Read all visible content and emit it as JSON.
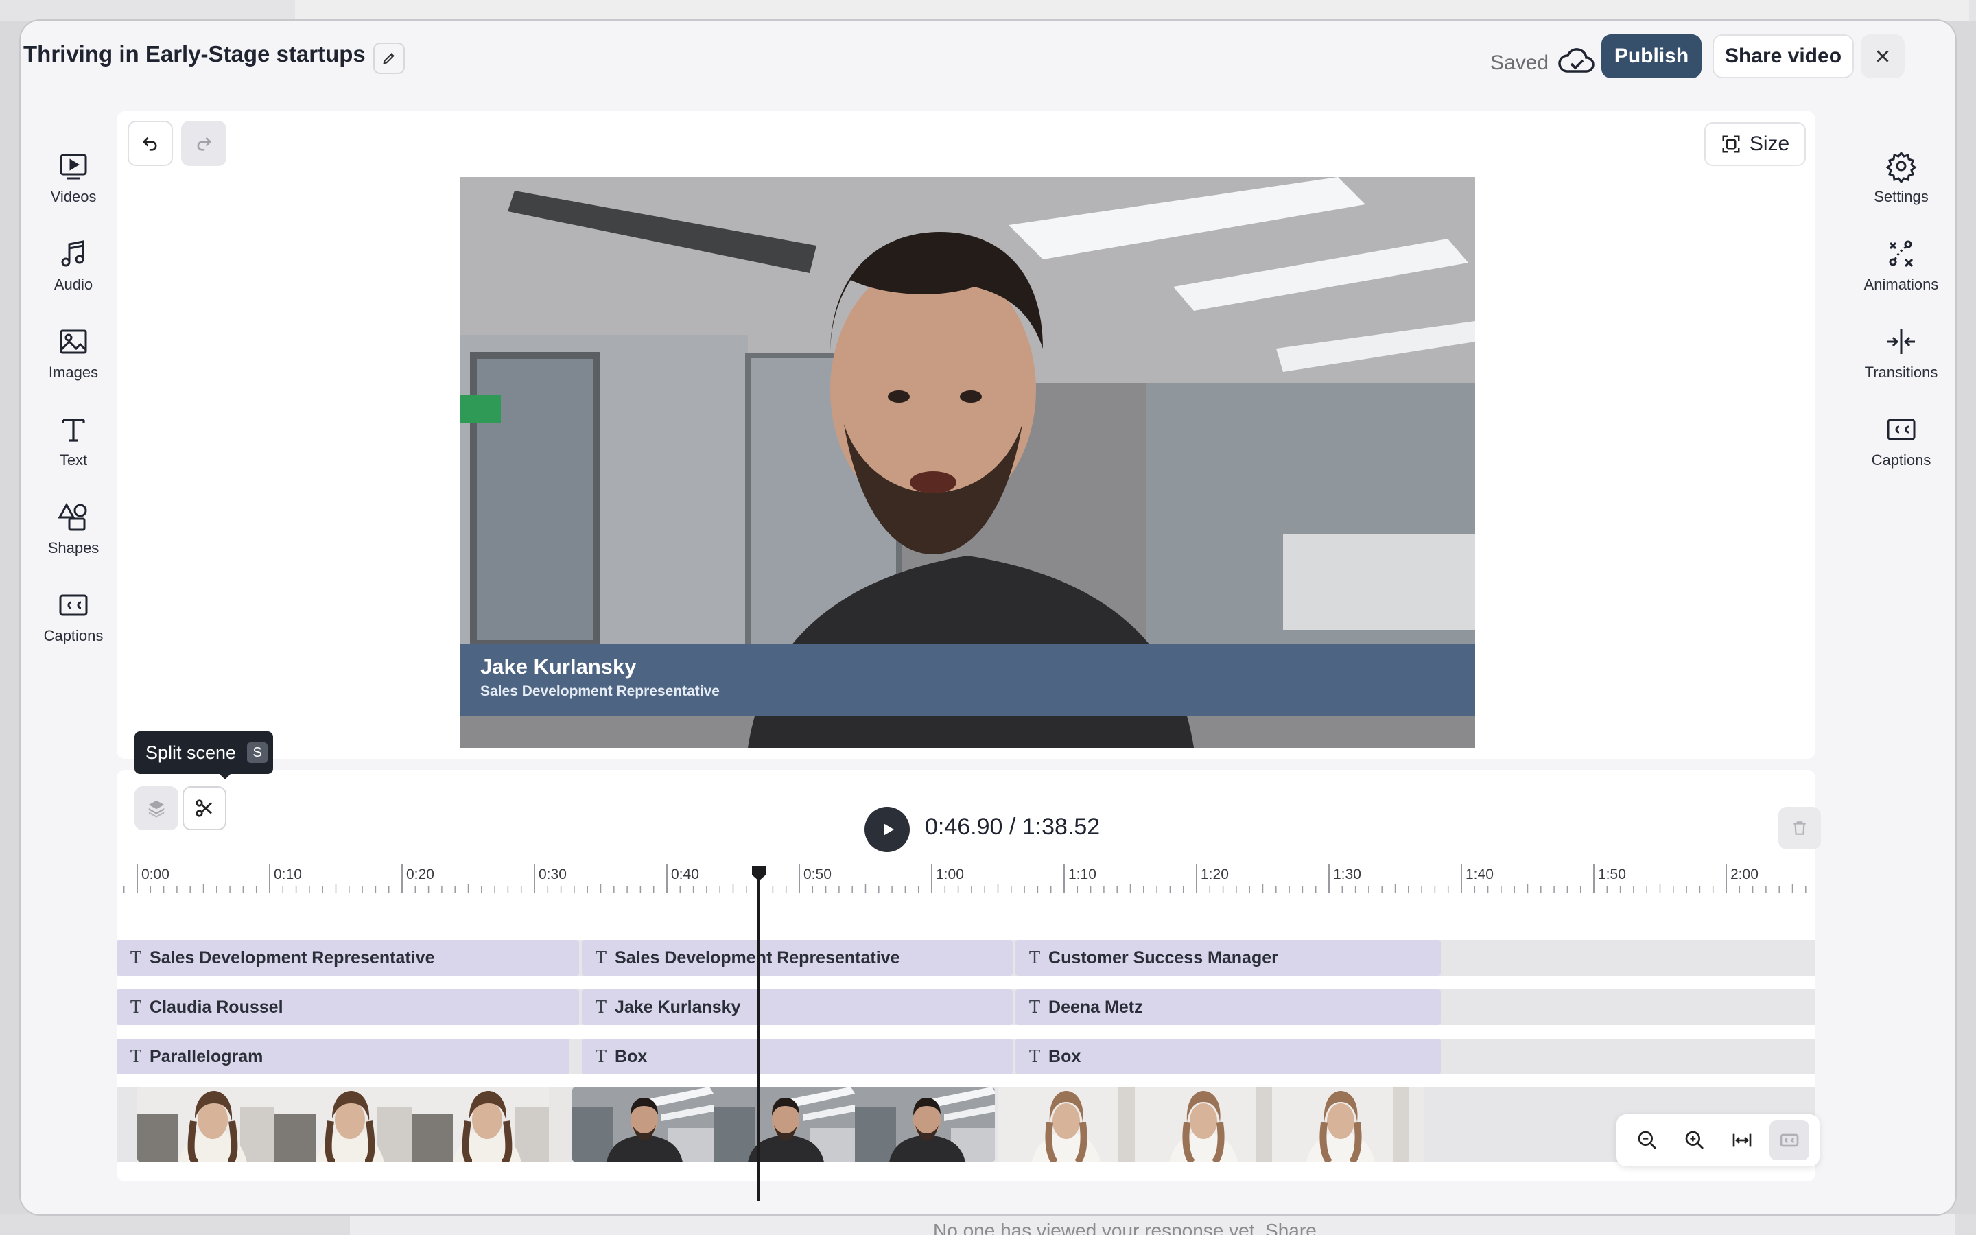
{
  "header": {
    "title": "Thriving in Early-Stage startups",
    "saved_label": "Saved",
    "publish_label": "Publish",
    "share_label": "Share video"
  },
  "left_toolbar": [
    {
      "label": "Videos",
      "icon": "videos-icon"
    },
    {
      "label": "Audio",
      "icon": "audio-icon"
    },
    {
      "label": "Images",
      "icon": "images-icon"
    },
    {
      "label": "Text",
      "icon": "text-icon"
    },
    {
      "label": "Shapes",
      "icon": "shapes-icon"
    },
    {
      "label": "Captions",
      "icon": "captions-icon"
    }
  ],
  "right_toolbar": [
    {
      "label": "Settings",
      "icon": "settings-icon"
    },
    {
      "label": "Animations",
      "icon": "animations-icon"
    },
    {
      "label": "Transitions",
      "icon": "transitions-icon"
    },
    {
      "label": "Captions",
      "icon": "captions-icon"
    }
  ],
  "canvas": {
    "size_label": "Size",
    "lower_third": {
      "name": "Jake Kurlansky",
      "role": "Sales Development Representative"
    }
  },
  "player": {
    "current_time": "0:46.90",
    "total_time": "1:38.52",
    "time_display": "0:46.90 / 1:38.52",
    "tooltip": "Split scene",
    "tooltip_shortcut": "S"
  },
  "ruler": {
    "labels": [
      "0:00",
      "0:10",
      "0:20",
      "0:30",
      "0:40",
      "0:50",
      "1:00",
      "1:10",
      "1:20",
      "1:30",
      "1:40",
      "1:50",
      "2:00"
    ]
  },
  "tracks": {
    "row1": [
      "Sales Development Representative",
      "Sales Development Representative",
      "Customer Success Manager"
    ],
    "row2": [
      "Claudia Roussel",
      "Jake Kurlansky",
      "Deena Metz"
    ],
    "row3": [
      "Parallelogram",
      "Box",
      "Box"
    ]
  },
  "background": {
    "footer_text": "No one has viewed your response yet. Share"
  },
  "colors": {
    "accent": "#364f6b",
    "lower_third": "#4d6482",
    "clip": "#d9d6eb"
  }
}
